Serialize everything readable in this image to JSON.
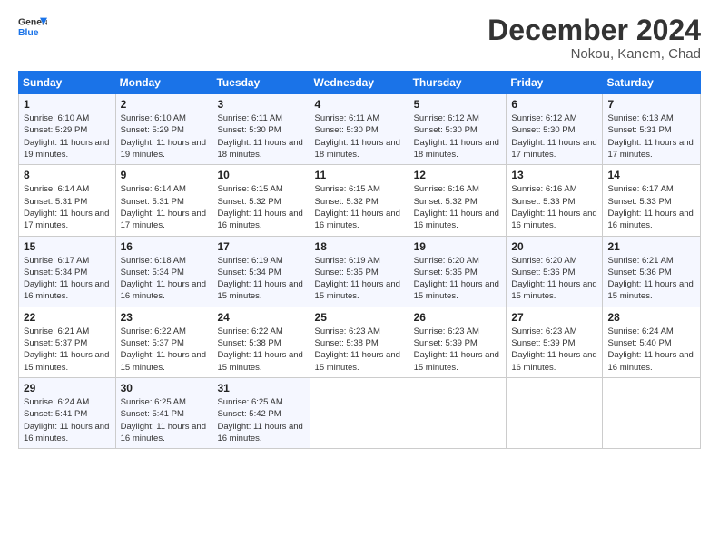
{
  "logo": {
    "line1": "General",
    "line2": "Blue"
  },
  "title": "December 2024",
  "subtitle": "Nokou, Kanem, Chad",
  "days_header": [
    "Sunday",
    "Monday",
    "Tuesday",
    "Wednesday",
    "Thursday",
    "Friday",
    "Saturday"
  ],
  "weeks": [
    [
      {
        "day": "1",
        "sunrise": "6:10 AM",
        "sunset": "5:29 PM",
        "daylight": "11 hours and 19 minutes."
      },
      {
        "day": "2",
        "sunrise": "6:10 AM",
        "sunset": "5:29 PM",
        "daylight": "11 hours and 19 minutes."
      },
      {
        "day": "3",
        "sunrise": "6:11 AM",
        "sunset": "5:30 PM",
        "daylight": "11 hours and 18 minutes."
      },
      {
        "day": "4",
        "sunrise": "6:11 AM",
        "sunset": "5:30 PM",
        "daylight": "11 hours and 18 minutes."
      },
      {
        "day": "5",
        "sunrise": "6:12 AM",
        "sunset": "5:30 PM",
        "daylight": "11 hours and 18 minutes."
      },
      {
        "day": "6",
        "sunrise": "6:12 AM",
        "sunset": "5:30 PM",
        "daylight": "11 hours and 17 minutes."
      },
      {
        "day": "7",
        "sunrise": "6:13 AM",
        "sunset": "5:31 PM",
        "daylight": "11 hours and 17 minutes."
      }
    ],
    [
      {
        "day": "8",
        "sunrise": "6:14 AM",
        "sunset": "5:31 PM",
        "daylight": "11 hours and 17 minutes."
      },
      {
        "day": "9",
        "sunrise": "6:14 AM",
        "sunset": "5:31 PM",
        "daylight": "11 hours and 17 minutes."
      },
      {
        "day": "10",
        "sunrise": "6:15 AM",
        "sunset": "5:32 PM",
        "daylight": "11 hours and 16 minutes."
      },
      {
        "day": "11",
        "sunrise": "6:15 AM",
        "sunset": "5:32 PM",
        "daylight": "11 hours and 16 minutes."
      },
      {
        "day": "12",
        "sunrise": "6:16 AM",
        "sunset": "5:32 PM",
        "daylight": "11 hours and 16 minutes."
      },
      {
        "day": "13",
        "sunrise": "6:16 AM",
        "sunset": "5:33 PM",
        "daylight": "11 hours and 16 minutes."
      },
      {
        "day": "14",
        "sunrise": "6:17 AM",
        "sunset": "5:33 PM",
        "daylight": "11 hours and 16 minutes."
      }
    ],
    [
      {
        "day": "15",
        "sunrise": "6:17 AM",
        "sunset": "5:34 PM",
        "daylight": "11 hours and 16 minutes."
      },
      {
        "day": "16",
        "sunrise": "6:18 AM",
        "sunset": "5:34 PM",
        "daylight": "11 hours and 16 minutes."
      },
      {
        "day": "17",
        "sunrise": "6:19 AM",
        "sunset": "5:34 PM",
        "daylight": "11 hours and 15 minutes."
      },
      {
        "day": "18",
        "sunrise": "6:19 AM",
        "sunset": "5:35 PM",
        "daylight": "11 hours and 15 minutes."
      },
      {
        "day": "19",
        "sunrise": "6:20 AM",
        "sunset": "5:35 PM",
        "daylight": "11 hours and 15 minutes."
      },
      {
        "day": "20",
        "sunrise": "6:20 AM",
        "sunset": "5:36 PM",
        "daylight": "11 hours and 15 minutes."
      },
      {
        "day": "21",
        "sunrise": "6:21 AM",
        "sunset": "5:36 PM",
        "daylight": "11 hours and 15 minutes."
      }
    ],
    [
      {
        "day": "22",
        "sunrise": "6:21 AM",
        "sunset": "5:37 PM",
        "daylight": "11 hours and 15 minutes."
      },
      {
        "day": "23",
        "sunrise": "6:22 AM",
        "sunset": "5:37 PM",
        "daylight": "11 hours and 15 minutes."
      },
      {
        "day": "24",
        "sunrise": "6:22 AM",
        "sunset": "5:38 PM",
        "daylight": "11 hours and 15 minutes."
      },
      {
        "day": "25",
        "sunrise": "6:23 AM",
        "sunset": "5:38 PM",
        "daylight": "11 hours and 15 minutes."
      },
      {
        "day": "26",
        "sunrise": "6:23 AM",
        "sunset": "5:39 PM",
        "daylight": "11 hours and 15 minutes."
      },
      {
        "day": "27",
        "sunrise": "6:23 AM",
        "sunset": "5:39 PM",
        "daylight": "11 hours and 16 minutes."
      },
      {
        "day": "28",
        "sunrise": "6:24 AM",
        "sunset": "5:40 PM",
        "daylight": "11 hours and 16 minutes."
      }
    ],
    [
      {
        "day": "29",
        "sunrise": "6:24 AM",
        "sunset": "5:41 PM",
        "daylight": "11 hours and 16 minutes."
      },
      {
        "day": "30",
        "sunrise": "6:25 AM",
        "sunset": "5:41 PM",
        "daylight": "11 hours and 16 minutes."
      },
      {
        "day": "31",
        "sunrise": "6:25 AM",
        "sunset": "5:42 PM",
        "daylight": "11 hours and 16 minutes."
      },
      null,
      null,
      null,
      null
    ]
  ],
  "labels": {
    "sunrise": "Sunrise:",
    "sunset": "Sunset:",
    "daylight": "Daylight:"
  }
}
